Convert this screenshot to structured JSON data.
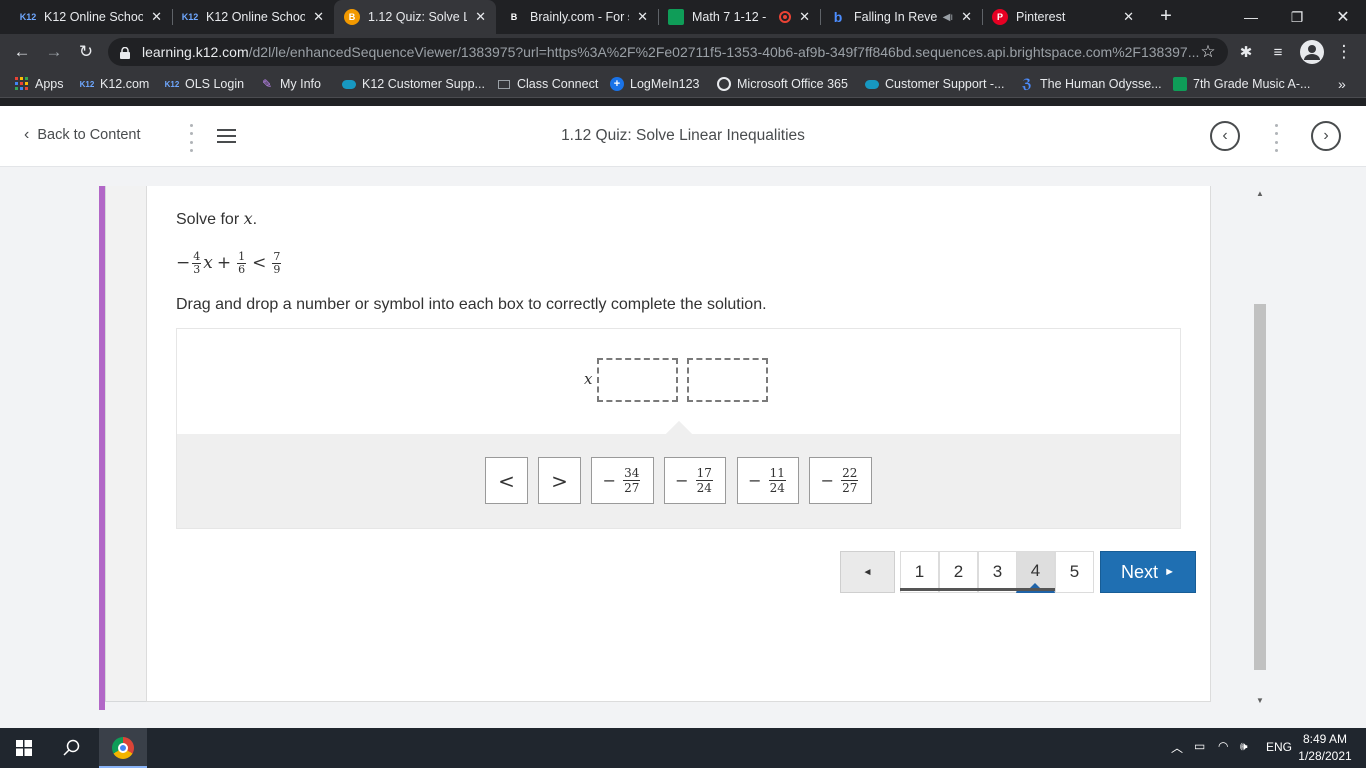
{
  "browser": {
    "tabs": [
      {
        "favicon": "K12",
        "title": "K12 Online School"
      },
      {
        "favicon": "K12",
        "title": "K12 Online School"
      },
      {
        "favicon": "B",
        "title": "1.12 Quiz: Solve Li"
      },
      {
        "favicon": "B",
        "title": "Brainly.com - For s"
      },
      {
        "favicon": "",
        "title": "Math 7 1-12 -"
      },
      {
        "favicon": "b",
        "title": "Falling In Reve"
      },
      {
        "favicon": "P",
        "title": "Pinterest"
      }
    ],
    "active_tab_index": 2,
    "url_host": "learning.k12.com",
    "url_path": "/d2l/le/enhancedSequenceViewer/1383975?url=https%3A%2F%2Fe02711f5-1353-40b6-af9b-349f7ff846bd.sequences.api.brightspace.com%2F138397...",
    "bookmarks": [
      {
        "icon": "apps-grid-icon",
        "label": "Apps"
      },
      {
        "icon": "K12",
        "label": "K12.com"
      },
      {
        "icon": "K12",
        "label": "OLS Login"
      },
      {
        "icon": "info-icon",
        "label": "My Info"
      },
      {
        "icon": "cloud-icon",
        "label": "K12 Customer Supp..."
      },
      {
        "icon": "class-icon",
        "label": "Class Connect"
      },
      {
        "icon": "plus-icon",
        "label": "LogMeIn123"
      },
      {
        "icon": "office-icon",
        "label": "Microsoft Office 365"
      },
      {
        "icon": "cloud-icon",
        "label": "Customer Support -..."
      },
      {
        "icon": "book-icon",
        "label": "The Human Odysse..."
      },
      {
        "icon": "sheet-icon",
        "label": "7th Grade Music A-..."
      }
    ],
    "bookmarks_overflow": "»"
  },
  "header": {
    "back_label": "Back to Content",
    "title": "1.12 Quiz: Solve Linear Inequalities"
  },
  "question": {
    "prompt_prefix": "Solve for ",
    "prompt_var": "x",
    "prompt_suffix": ".",
    "equation": {
      "lead_sign": "−",
      "coef_num": "4",
      "coef_den": "3",
      "var": "x",
      "plus": "+",
      "const_num": "1",
      "const_den": "6",
      "relation": "<",
      "rhs_num": "7",
      "rhs_den": "9"
    },
    "instructions": "Drag and drop a number or symbol into each box to correctly complete the solution.",
    "answer_var": "x",
    "choices": [
      {
        "type": "symbol",
        "text": "<"
      },
      {
        "type": "symbol",
        "text": ">"
      },
      {
        "type": "fraction",
        "sign": "−",
        "num": "34",
        "den": "27"
      },
      {
        "type": "fraction",
        "sign": "−",
        "num": "17",
        "den": "24"
      },
      {
        "type": "fraction",
        "sign": "−",
        "num": "11",
        "den": "24"
      },
      {
        "type": "fraction",
        "sign": "−",
        "num": "22",
        "den": "27"
      }
    ]
  },
  "pager": {
    "prev_symbol": "◄",
    "pages": [
      "1",
      "2",
      "3",
      "4",
      "5"
    ],
    "current_page": 4,
    "next_label": "Next",
    "next_arrow": "►"
  },
  "taskbar": {
    "language": "ENG",
    "time": "8:49 AM",
    "date": "1/28/2021"
  },
  "colors": {
    "accent_purple": "#b267c7",
    "next_blue": "#1f6fb2",
    "chrome_dark": "#202124"
  }
}
